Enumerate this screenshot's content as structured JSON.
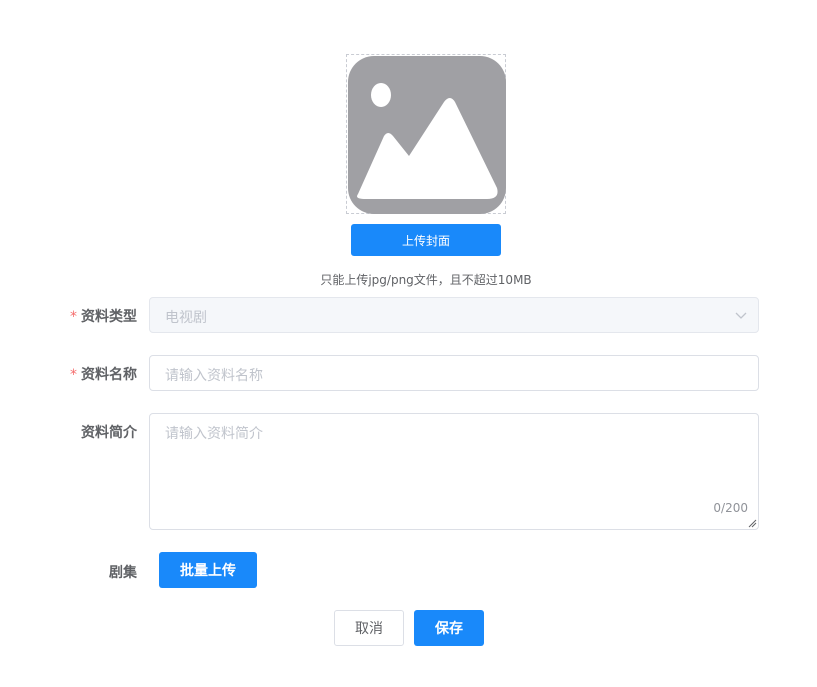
{
  "cover": {
    "image_icon": "image-placeholder-icon",
    "upload_label": "上传封面",
    "hint": "只能上传jpg/png文件，且不超过10MB"
  },
  "form": {
    "type": {
      "required_mark": "*",
      "label": "资料类型",
      "value": "电视剧",
      "disabled": true,
      "arrow_icon": "chevron-down-icon"
    },
    "name": {
      "required_mark": "*",
      "label": "资料名称",
      "placeholder": "请输入资料名称"
    },
    "intro": {
      "label": "资料简介",
      "placeholder": "请输入资料简介",
      "counter": "0/200"
    },
    "episodes": {
      "label": "剧集",
      "button_label": "批量上传"
    }
  },
  "footer": {
    "cancel_label": "取消",
    "save_label": "保存"
  },
  "colors": {
    "primary": "#1989fa",
    "required": "#f56c6c",
    "placeholder_image": "#a0a0a4"
  }
}
